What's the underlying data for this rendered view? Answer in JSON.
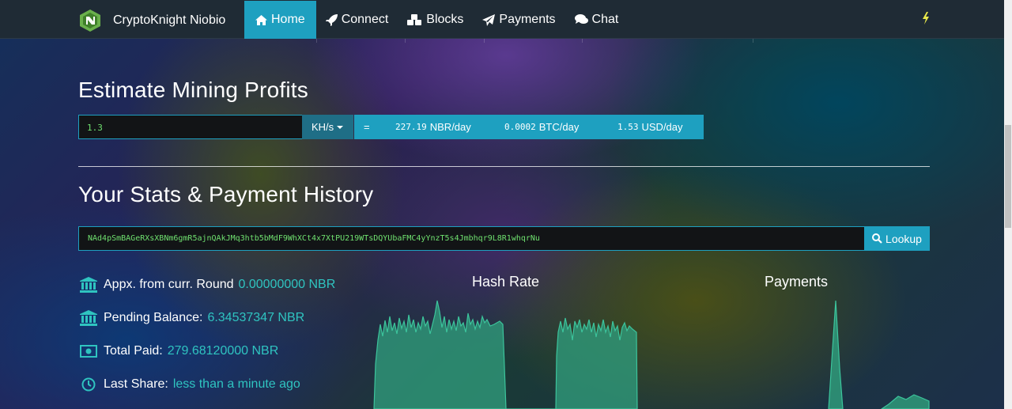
{
  "navbar": {
    "brand": "CryptoKnight Niobio",
    "items": [
      {
        "label": "Home",
        "icon": "home-icon",
        "active": true
      },
      {
        "label": "Connect",
        "icon": "rocket-icon"
      },
      {
        "label": "Blocks",
        "icon": "cubes-icon"
      },
      {
        "label": "Payments",
        "icon": "paper-plane-icon"
      },
      {
        "label": "Chat",
        "icon": "comments-icon"
      }
    ],
    "right_icon": "bolt-icon"
  },
  "estimate": {
    "heading": "Estimate Mining Profits",
    "hashrate_value": "1.3",
    "unit": "KH/s",
    "equals": "=",
    "nbr_value": "227.19",
    "nbr_unit": "NBR/day",
    "btc_value": "0.0002",
    "btc_unit": "BTC/day",
    "usd_value": "1.53",
    "usd_unit": "USD/day"
  },
  "stats": {
    "heading": "Your Stats & Payment History",
    "address": "NAd4pSmBAGeRXsXBNm6gmR5ajnQAkJMq3htb5bMdF9WhXCt4x7XtPU219WTsDQYUbaFMC4yYnzT5s4Jmbhqr9L8R1whqrNu",
    "lookup_label": "Lookup",
    "rows": [
      {
        "label": "Appx. from curr. Round",
        "value": "0.00000000 NBR",
        "icon": "bank-icon"
      },
      {
        "label": "Pending Balance:",
        "value": "6.34537347 NBR",
        "icon": "bank-icon"
      },
      {
        "label": "Total Paid:",
        "value": "279.68120000 NBR",
        "icon": "money-icon"
      },
      {
        "label": "Last Share:",
        "value": "less than a minute ago",
        "icon": "clock-icon"
      }
    ]
  },
  "charts": {
    "hash_title": "Hash Rate",
    "payments_title": "Payments",
    "accent": "#2fc4c0",
    "fill": "#2f9a7a"
  }
}
